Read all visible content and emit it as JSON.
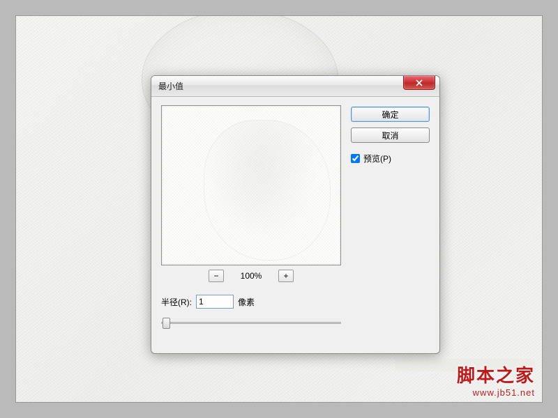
{
  "dialog": {
    "title": "最小值",
    "ok_label": "确定",
    "cancel_label": "取消",
    "preview_label": "预览(P)",
    "preview_checked": true,
    "zoom_value": "100%",
    "zoom_out_glyph": "−",
    "zoom_in_glyph": "+",
    "radius_label": "半径(R):",
    "radius_value": "1",
    "radius_unit": "像素"
  },
  "watermark": {
    "cn": "脚本之家",
    "url": "www.jb51.net"
  }
}
